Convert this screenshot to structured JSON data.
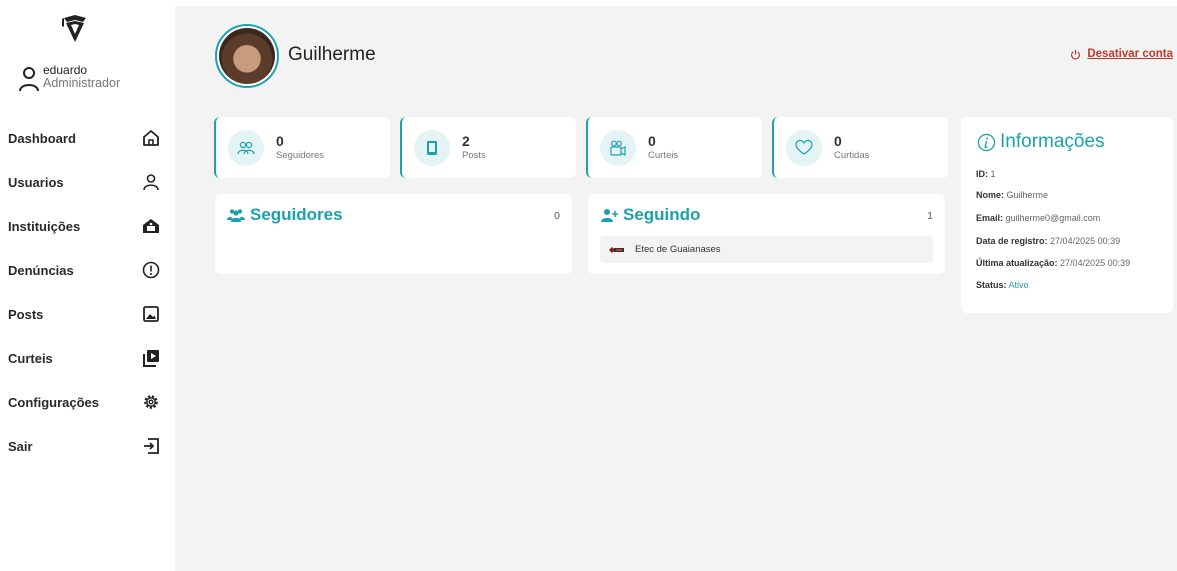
{
  "sidebar": {
    "user": {
      "name": "eduardo",
      "role": "Administrador"
    },
    "items": [
      {
        "label": "Dashboard",
        "icon": "home-icon"
      },
      {
        "label": "Usuarios",
        "icon": "user-icon"
      },
      {
        "label": "Instituições",
        "icon": "institution-icon"
      },
      {
        "label": "Denúncias",
        "icon": "alert-icon"
      },
      {
        "label": "Posts",
        "icon": "image-icon"
      },
      {
        "label": "Curteis",
        "icon": "video-icon"
      },
      {
        "label": "Configurações",
        "icon": "gear-icon"
      },
      {
        "label": "Sair",
        "icon": "logout-icon"
      }
    ]
  },
  "profile": {
    "name": "Guilherme",
    "deactivate_label": "Desativar conta"
  },
  "stats": [
    {
      "value": "0",
      "label": "Seguidores",
      "icon": "followers-icon"
    },
    {
      "value": "2",
      "label": "Posts",
      "icon": "tablet-icon"
    },
    {
      "value": "0",
      "label": "Curteis",
      "icon": "video-camera-icon"
    },
    {
      "value": "0",
      "label": "Curtidas",
      "icon": "heart-icon"
    }
  ],
  "followers": {
    "title": "Seguidores",
    "count": "0"
  },
  "following": {
    "title": "Seguindo",
    "count": "1",
    "items": [
      {
        "name": "Etec de Guaianases"
      }
    ]
  },
  "info": {
    "title": "Informações",
    "id_label": "ID:",
    "id_value": "1",
    "name_label": "Nome:",
    "name_value": "Guilherme",
    "email_label": "Email:",
    "email_value": "guilherme0@gmail.com",
    "created_label": "Data de registro:",
    "created_value": "27/04/2025 00:39",
    "updated_label": "Última atualização:",
    "updated_value": "27/04/2025 00:39",
    "status_label": "Status:",
    "status_value": "Ativo"
  },
  "colors": {
    "accent": "#1ba3ad",
    "danger": "#c0392b",
    "background": "#f3f3f3"
  }
}
